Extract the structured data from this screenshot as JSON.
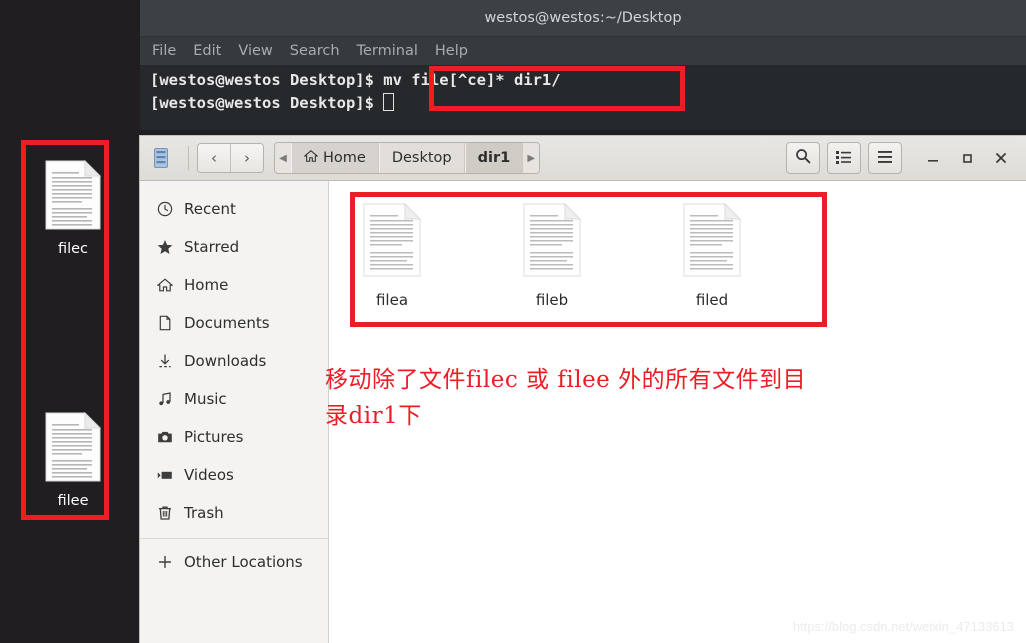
{
  "desktop": {
    "icons": [
      {
        "label": "filec",
        "icon": "document-icon"
      },
      {
        "label": "filee",
        "icon": "document-icon"
      }
    ]
  },
  "terminal": {
    "title": "westos@westos:~/Desktop",
    "menu": [
      "File",
      "Edit",
      "View",
      "Search",
      "Terminal",
      "Help"
    ],
    "lines": [
      {
        "prompt": "[westos@westos Desktop]$ ",
        "command": "mv file[^ce]* dir1/"
      },
      {
        "prompt": "[westos@westos Desktop]$ ",
        "command": ""
      }
    ]
  },
  "filemanager": {
    "app_icon": "files-app-icon",
    "nav": {
      "back": "‹",
      "forward": "›",
      "back_name": "back-button",
      "forward_name": "forward-button"
    },
    "breadcrumb": {
      "left_arrow": "◀",
      "right_arrow": "▶",
      "items": [
        {
          "label": "Home",
          "icon": "home-icon",
          "current": false
        },
        {
          "label": "Desktop",
          "icon": "",
          "current": false
        },
        {
          "label": "dir1",
          "icon": "",
          "current": true
        }
      ]
    },
    "toolbar": [
      {
        "name": "search-button",
        "icon": "search-icon"
      },
      {
        "name": "view-list-button",
        "icon": "list-view-icon"
      },
      {
        "name": "menu-button",
        "icon": "hamburger-menu-icon"
      }
    ],
    "window_controls": [
      {
        "name": "minimize-button",
        "glyph": "—"
      },
      {
        "name": "maximize-button",
        "glyph": "▫"
      },
      {
        "name": "close-button",
        "glyph": "✕"
      }
    ],
    "sidebar": {
      "items": [
        {
          "label": "Recent",
          "icon": "clock-icon"
        },
        {
          "label": "Starred",
          "icon": "star-icon"
        },
        {
          "label": "Home",
          "icon": "home-icon"
        },
        {
          "label": "Documents",
          "icon": "document-icon"
        },
        {
          "label": "Downloads",
          "icon": "download-icon"
        },
        {
          "label": "Music",
          "icon": "music-note-icon"
        },
        {
          "label": "Pictures",
          "icon": "camera-icon"
        },
        {
          "label": "Videos",
          "icon": "video-icon"
        },
        {
          "label": "Trash",
          "icon": "trash-icon"
        }
      ],
      "other_locations": {
        "label": "Other Locations",
        "icon": "plus-icon"
      }
    },
    "files": [
      {
        "label": "filea",
        "icon": "document-icon"
      },
      {
        "label": "fileb",
        "icon": "document-icon"
      },
      {
        "label": "filed",
        "icon": "document-icon"
      }
    ]
  },
  "annotation": {
    "text_line1": "移动除了文件filec 或 filee 外的所有文件到目",
    "text_line2": "录dir1下",
    "color": "#ee1c25"
  },
  "watermark": "https://blog.csdn.net/weixin_47133613"
}
